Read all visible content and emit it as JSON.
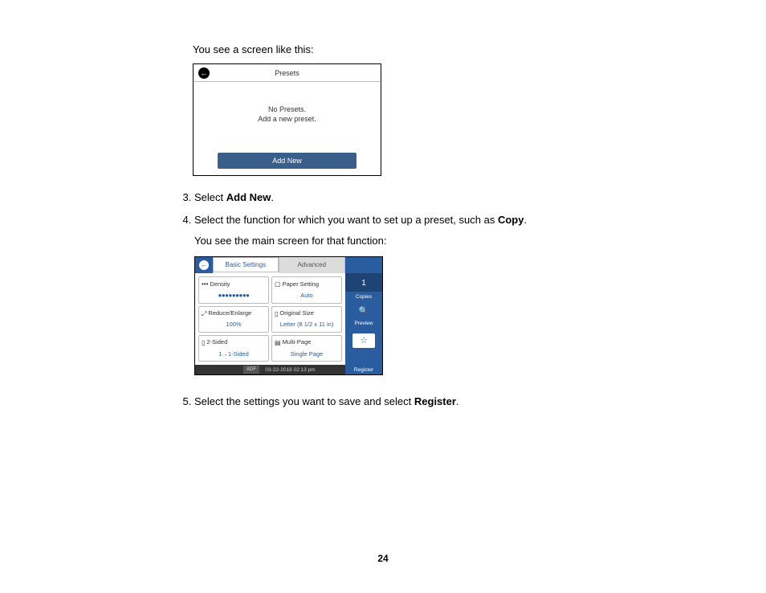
{
  "intro": "You see a screen like this:",
  "screenshot1": {
    "title": "Presets",
    "empty_line1": "No Presets.",
    "empty_line2": "Add a new preset.",
    "add_button": "Add New"
  },
  "steps": {
    "s3_prefix": "Select ",
    "s3_bold": "Add New",
    "s3_suffix": ".",
    "s4_prefix": "Select the function for which you want to set up a preset, such as ",
    "s4_bold": "Copy",
    "s4_suffix": ".",
    "s4_sub": "You see the main screen for that function:",
    "s5_prefix": "Select the settings you want to save and select ",
    "s5_bold": "Register",
    "s5_suffix": "."
  },
  "screenshot2": {
    "tabs": {
      "basic": "Basic Settings",
      "advanced": "Advanced"
    },
    "cells": {
      "density_label": "Density",
      "density_value": "●●●●●●●●●",
      "paper_label": "Paper Setting",
      "paper_value": "Auto",
      "reduce_label": "Reduce/Enlarge",
      "reduce_value": "100%",
      "original_label": "Original Size",
      "original_value": "Letter (8 1/2 x 11 in)",
      "twosided_label": "2-Sided",
      "twosided_value": "1→1-Sided",
      "multipage_label": "Multi-Page",
      "multipage_value": "Single Page"
    },
    "sidebar": {
      "copies_num": "1",
      "copies_label": "Copies",
      "preview_label": "Preview",
      "register_label": "Register"
    },
    "bottom": {
      "adf": "ADF",
      "datetime": "03-22-2018 02:13 pm"
    }
  },
  "page_number": "24"
}
